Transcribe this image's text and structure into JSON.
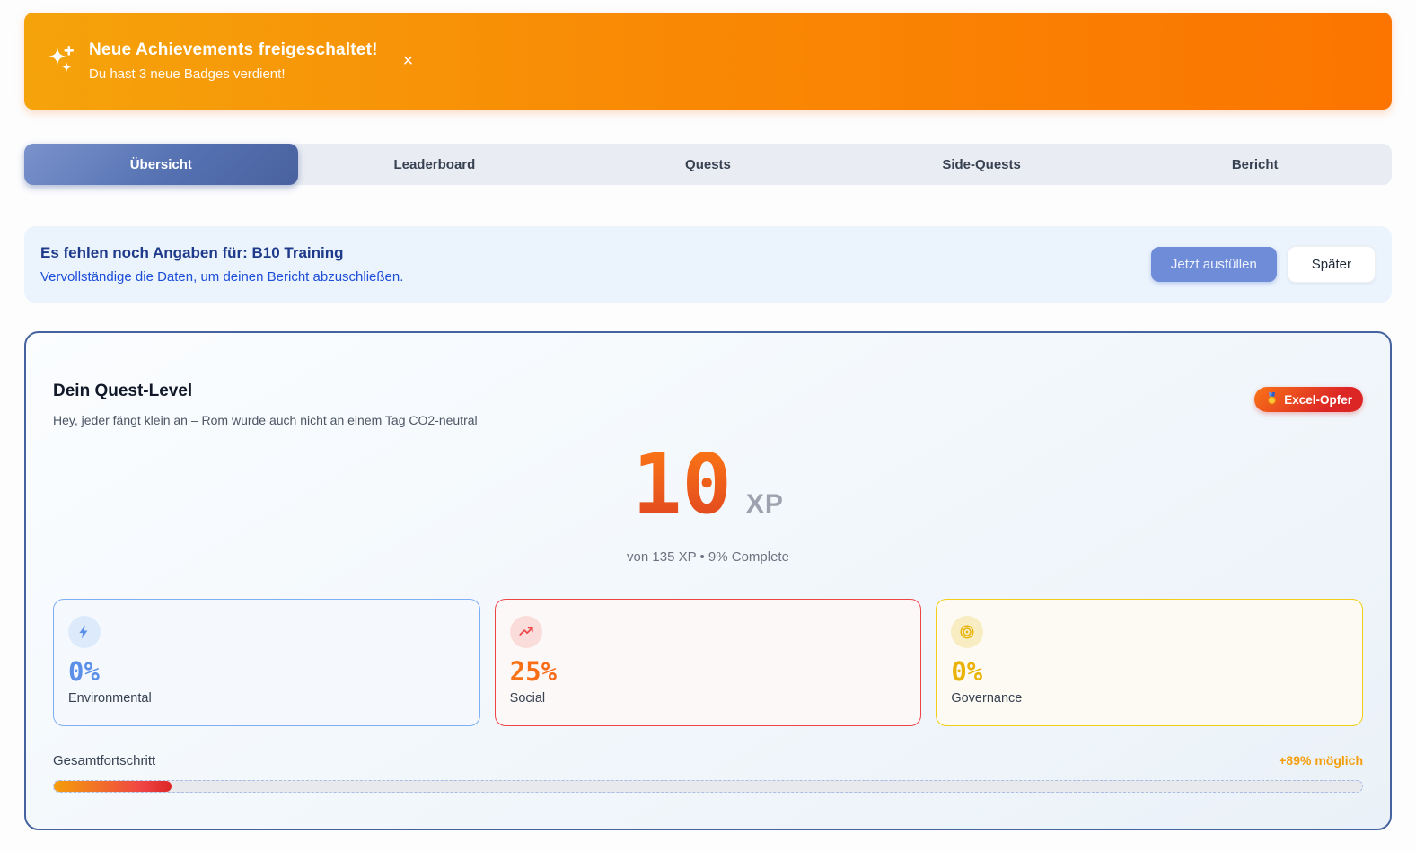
{
  "achievement_banner": {
    "title": "Neue Achievements freigeschaltet!",
    "subtitle": "Du hast 3 neue Badges verdient!",
    "close_label": "×"
  },
  "tabs": {
    "items": [
      {
        "label": "Übersicht",
        "active": true
      },
      {
        "label": "Leaderboard",
        "active": false
      },
      {
        "label": "Quests",
        "active": false
      },
      {
        "label": "Side-Quests",
        "active": false
      },
      {
        "label": "Bericht",
        "active": false
      }
    ]
  },
  "missing_info_banner": {
    "title": "Es fehlen noch Angaben für: B10 Training",
    "subtitle": "Vervollständige die Daten, um deinen Bericht abzuschließen.",
    "primary_button": "Jetzt ausfüllen",
    "secondary_button": "Später"
  },
  "quest_level": {
    "title": "Dein Quest-Level",
    "subtitle": "Hey, jeder fängt klein an – Rom wurde auch nicht an einem Tag CO2-neutral",
    "badge_label": "Excel-Opfer",
    "badge_icon": "medal-icon",
    "xp_value": "10",
    "xp_unit": "XP",
    "xp_summary": "von 135 XP • 9% Complete",
    "categories": [
      {
        "name": "Environmental",
        "percent": "0%",
        "icon": "bolt-icon",
        "color": "#5B8FE8"
      },
      {
        "name": "Social",
        "percent": "25%",
        "icon": "trend-up-icon",
        "color": "#EF4444"
      },
      {
        "name": "Governance",
        "percent": "0%",
        "icon": "target-icon",
        "color": "#EAB308"
      }
    ],
    "progress": {
      "label": "Gesamtfortschritt",
      "possible": "+89% möglich",
      "percent": 9
    }
  }
}
